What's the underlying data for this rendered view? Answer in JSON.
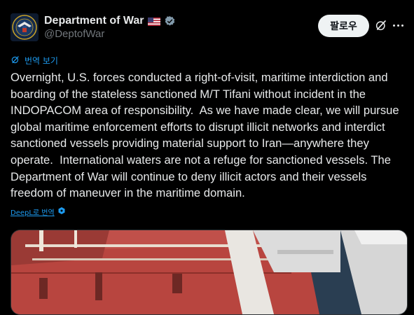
{
  "author": {
    "name": "Department of War",
    "handle": "@DeptofWar"
  },
  "follow_label": "팔로우",
  "translate_label": "번역 보기",
  "tweet_text": "Overnight, U.S. forces conducted a right-of-visit, maritime interdiction and boarding of the stateless sanctioned M/T Tifani without incident in the INDOPACOM area of responsibility.  As we have made clear, we will pursue global maritime enforcement efforts to disrupt illicit networks and interdict sanctioned vessels providing material support to Iran—anywhere they operate.  International waters are not a refuge for sanctioned vessels. The Department of War will continue to deny illicit actors and their vessels freedom of maneuver in the maritime domain.",
  "deepl_label": "DeepL로 번역",
  "colors": {
    "background": "#000000",
    "text": "#e7e9ea",
    "muted": "#71767b",
    "link": "#1d9bf0",
    "deck": "#c0504a"
  },
  "icons": {
    "verified": "verified-badge-icon",
    "flag": "us-flag-icon",
    "grok": "grok-icon",
    "more": "more-icon",
    "translate": "translate-icon"
  }
}
